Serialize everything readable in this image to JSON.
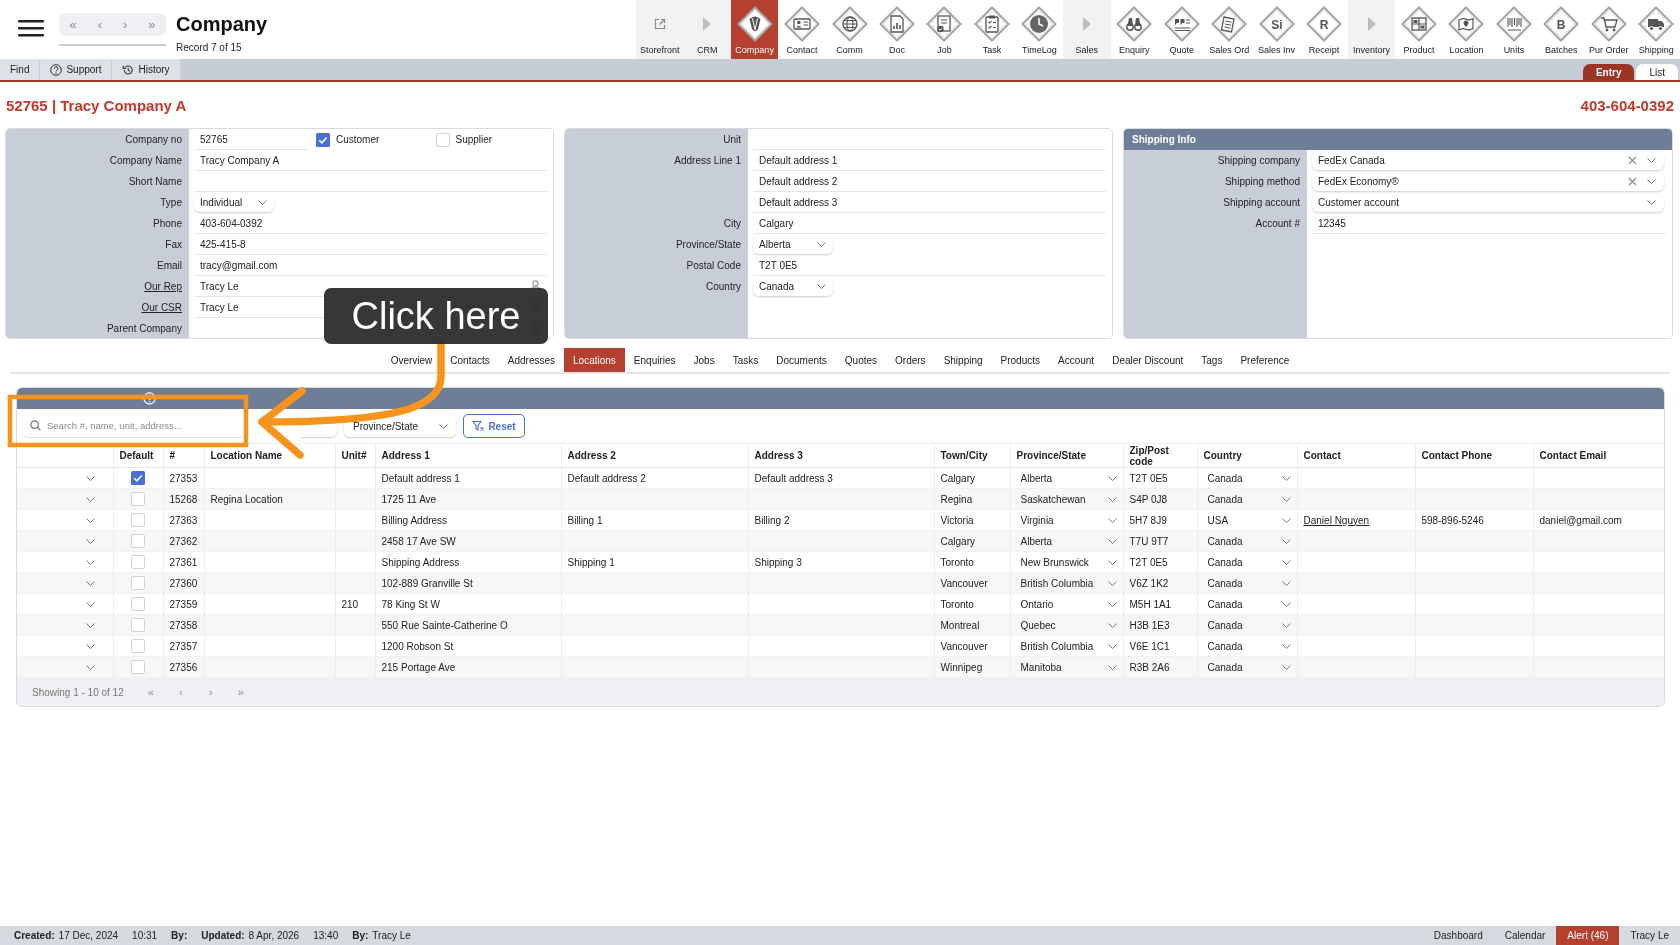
{
  "app_bar": {
    "nav_buttons": [
      "«",
      "‹",
      "›",
      "»"
    ],
    "title": "Company",
    "record": "Record 7 of 15",
    "modules": [
      {
        "label": "Storefront",
        "kind": "link",
        "selected": false
      },
      {
        "label": "CRM",
        "kind": "section",
        "selected": false
      },
      {
        "label": "Company",
        "kind": "module",
        "selected": true
      },
      {
        "label": "Contact",
        "kind": "module",
        "selected": false
      },
      {
        "label": "Comm",
        "kind": "module",
        "selected": false
      },
      {
        "label": "Doc",
        "kind": "module",
        "selected": false
      },
      {
        "label": "Job",
        "kind": "module",
        "selected": false
      },
      {
        "label": "Task",
        "kind": "module",
        "selected": false
      },
      {
        "label": "TimeLog",
        "kind": "module",
        "selected": false
      },
      {
        "label": "Sales",
        "kind": "section",
        "selected": false
      },
      {
        "label": "Enquiry",
        "kind": "module",
        "selected": false
      },
      {
        "label": "Quote",
        "kind": "module",
        "selected": false
      },
      {
        "label": "Sales Ord",
        "kind": "module",
        "selected": false
      },
      {
        "label": "Sales Inv",
        "kind": "module",
        "glyph": "Si",
        "selected": false
      },
      {
        "label": "Receipt",
        "kind": "module",
        "glyph": "R",
        "selected": false
      },
      {
        "label": "Inventory",
        "kind": "section",
        "selected": false
      },
      {
        "label": "Product",
        "kind": "module",
        "selected": false
      },
      {
        "label": "Location",
        "kind": "module",
        "selected": false
      },
      {
        "label": "Units",
        "kind": "module",
        "selected": false
      },
      {
        "label": "Batches",
        "kind": "module",
        "glyph": "B",
        "selected": false
      },
      {
        "label": "Pur Order",
        "kind": "module",
        "selected": false
      },
      {
        "label": "Shipping",
        "kind": "module",
        "selected": false
      }
    ]
  },
  "toolbar": {
    "buttons": [
      {
        "label": "Find",
        "kind": "plain"
      },
      {
        "label": "Support",
        "kind": "help"
      },
      {
        "label": "History",
        "kind": "history"
      }
    ],
    "views": [
      {
        "label": "Entry",
        "selected": true
      },
      {
        "label": "List",
        "selected": false
      }
    ]
  },
  "record": {
    "title": "52765 | Tracy Company A",
    "phone": "403-604-0392"
  },
  "company": {
    "fields": [
      {
        "label": "Company no",
        "kind": "text",
        "value": "52765",
        "link": false,
        "checkboxes": [
          {
            "label": "Customer",
            "checked": true
          },
          {
            "label": "Supplier",
            "checked": false
          }
        ]
      },
      {
        "label": "Company Name",
        "kind": "text",
        "value": "Tracy Company A",
        "link": false
      },
      {
        "label": "Short Name",
        "kind": "text",
        "link": false
      },
      {
        "label": "Type",
        "kind": "select",
        "value": "Individual",
        "link": false
      },
      {
        "label": "Phone",
        "kind": "text",
        "value": "403-604-0392",
        "link": false
      },
      {
        "label": "Fax",
        "kind": "text",
        "value": "425-415-8",
        "link": false
      },
      {
        "label": "Email",
        "kind": "text",
        "value": "tracy@gmail.com",
        "link": false
      },
      {
        "label": "Our Rep",
        "kind": "person",
        "value": "Tracy Le",
        "link": true
      },
      {
        "label": "Our CSR",
        "kind": "person",
        "value": "Tracy Le",
        "link": true
      },
      {
        "label": "Parent Company",
        "kind": "record",
        "link": false
      }
    ]
  },
  "address": {
    "fields": [
      {
        "label": "Unit",
        "kind": "text"
      },
      {
        "label": "Address Line 1",
        "kind": "text",
        "value": "Default address 1"
      },
      {
        "kind": "text",
        "value": "Default address 2"
      },
      {
        "kind": "text",
        "value": "Default address 3"
      },
      {
        "label": "City",
        "kind": "text",
        "value": "Calgary"
      },
      {
        "label": "Province/State",
        "kind": "select",
        "value": "Alberta"
      },
      {
        "label": "Postal Code",
        "kind": "text",
        "value": "T2T 0E5"
      },
      {
        "label": "Country",
        "kind": "select",
        "value": "Canada"
      }
    ]
  },
  "shipping": {
    "title": "Shipping Info",
    "fields": [
      {
        "label": "Shipping company",
        "kind": "combo",
        "value": "FedEx Canada",
        "clearable": true
      },
      {
        "label": "Shipping method",
        "kind": "combo",
        "value": "FedEx Economy®",
        "clearable": true
      },
      {
        "label": "Shipping account",
        "kind": "combo",
        "value": "Customer account",
        "clearable": false
      },
      {
        "label": "Account #",
        "kind": "text",
        "value": "12345"
      }
    ]
  },
  "callout": {
    "text": "Click here"
  },
  "tabs": [
    {
      "label": "Overview",
      "selected": false
    },
    {
      "label": "Contacts",
      "selected": false
    },
    {
      "label": "Addresses",
      "selected": false
    },
    {
      "label": "Locations",
      "selected": true
    },
    {
      "label": "Enquiries",
      "selected": false
    },
    {
      "label": "Jobs",
      "selected": false
    },
    {
      "label": "Tasks",
      "selected": false
    },
    {
      "label": "Documents",
      "selected": false
    },
    {
      "label": "Quotes",
      "selected": false
    },
    {
      "label": "Orders",
      "selected": false
    },
    {
      "label": "Shipping",
      "selected": false
    },
    {
      "label": "Products",
      "selected": false
    },
    {
      "label": "Account",
      "selected": false
    },
    {
      "label": "Dealer Discount",
      "selected": false
    },
    {
      "label": "Tags",
      "selected": false
    },
    {
      "label": "Preference",
      "selected": false
    }
  ],
  "locations": {
    "search": {
      "placeholder": "Search #, name, unit, address..."
    },
    "filters": [
      {
        "kind": "select"
      },
      {
        "kind": "select",
        "placeholder": "Province/State"
      }
    ],
    "reset": {
      "label": "Reset"
    },
    "columns": [
      {
        "label": "Default",
        "kind": "check"
      },
      {
        "label": "#",
        "kind": "text"
      },
      {
        "label": "Location Name",
        "kind": "text"
      },
      {
        "label": "Unit#",
        "kind": "text"
      },
      {
        "label": "Address 1",
        "kind": "text"
      },
      {
        "label": "Address 2",
        "kind": "text"
      },
      {
        "label": "Address 3",
        "kind": "text"
      },
      {
        "label": "Town/City",
        "kind": "text"
      },
      {
        "label": "Province/State",
        "kind": "select"
      },
      {
        "label": "Zip/Post code",
        "kind": "text"
      },
      {
        "label": "Country",
        "kind": "select"
      },
      {
        "label": "Contact",
        "kind": "link"
      },
      {
        "label": "Contact Phone",
        "kind": "text"
      },
      {
        "label": "Contact Email",
        "kind": "text"
      }
    ],
    "rows": [
      {
        "expanded": false,
        "default": true,
        "number": "27353",
        "address_1": "Default address 1",
        "address_2": "Default address 2",
        "address_3": "Default address 3",
        "city": "Calgary",
        "province": "Alberta",
        "zip": "T2T 0E5",
        "country": "Canada"
      },
      {
        "expanded": false,
        "default": false,
        "number": "15268",
        "location_name": "Regina Location",
        "address_1": "1725 11 Ave",
        "city": "Regina",
        "province": "Saskatchewan",
        "zip": "S4P 0J8",
        "country": "Canada"
      },
      {
        "expanded": false,
        "default": false,
        "number": "27363",
        "address_1": "Billing Address",
        "address_2": "Billing 1",
        "address_3": "Billing 2",
        "city": "Victoria",
        "province": "Virginia",
        "zip": "5H7 8J9",
        "country": "USA",
        "contact": "Daniel Nguyen",
        "contact_phone": "598-896-5246",
        "contact_email": "daniel@gmail.com"
      },
      {
        "expanded": false,
        "default": false,
        "number": "27362",
        "address_1": "2458 17 Ave SW",
        "city": "Calgary",
        "province": "Alberta",
        "zip": "T7U 9T7",
        "country": "Canada"
      },
      {
        "expanded": false,
        "default": false,
        "number": "27361",
        "address_1": "Shipping Address",
        "address_2": "Shipping 1",
        "address_3": "Shipping 3",
        "city": "Toronto",
        "province": "New Brunswick",
        "zip": "T2T 0E5",
        "country": "Canada"
      },
      {
        "expanded": false,
        "default": false,
        "number": "27360",
        "address_1": "102-889 Granville St",
        "city": "Vancouver",
        "province": "British Columbia",
        "zip": "V6Z 1K2",
        "country": "Canada"
      },
      {
        "expanded": false,
        "default": false,
        "number": "27359",
        "unit": "210",
        "address_1": "78 King St W",
        "city": "Toronto",
        "province": "Ontario",
        "zip": "M5H 1A1",
        "country": "Canada"
      },
      {
        "expanded": false,
        "default": false,
        "number": "27358",
        "address_1": "550 Rue Sainte-Catherine O",
        "city": "Montreal",
        "province": "Quebec",
        "zip": "H3B 1E3",
        "country": "Canada"
      },
      {
        "expanded": false,
        "default": false,
        "number": "27357",
        "address_1": "1200 Robson St",
        "city": "Vancouver",
        "province": "British Columbia",
        "zip": "V6E 1C1",
        "country": "Canada"
      },
      {
        "expanded": false,
        "default": false,
        "number": "27356",
        "address_1": "215 Portage Ave",
        "city": "Winnipeg",
        "province": "Manitoba",
        "zip": "R3B 2A6",
        "country": "Canada"
      }
    ],
    "footer": {
      "summary": "Showing 1 - 10 of 12",
      "pager": [
        "«",
        "‹",
        "›",
        "»"
      ]
    }
  },
  "status_bar": {
    "entries": [
      {
        "label": "Created:",
        "value": "17 Dec, 2024"
      },
      {
        "value": "10:31"
      },
      {
        "label": "By:"
      },
      {
        "label": "Updated:",
        "value": "8 Apr, 2026"
      },
      {
        "value": "13:40"
      },
      {
        "label": "By:",
        "value": "Tracy Le"
      }
    ],
    "links": [
      {
        "label": "Dashboard",
        "kind": "link"
      },
      {
        "label": "Calendar",
        "kind": "link"
      },
      {
        "label": "Alert (46)",
        "kind": "alert"
      },
      {
        "label": "Tracy Le",
        "kind": "link"
      }
    ]
  }
}
